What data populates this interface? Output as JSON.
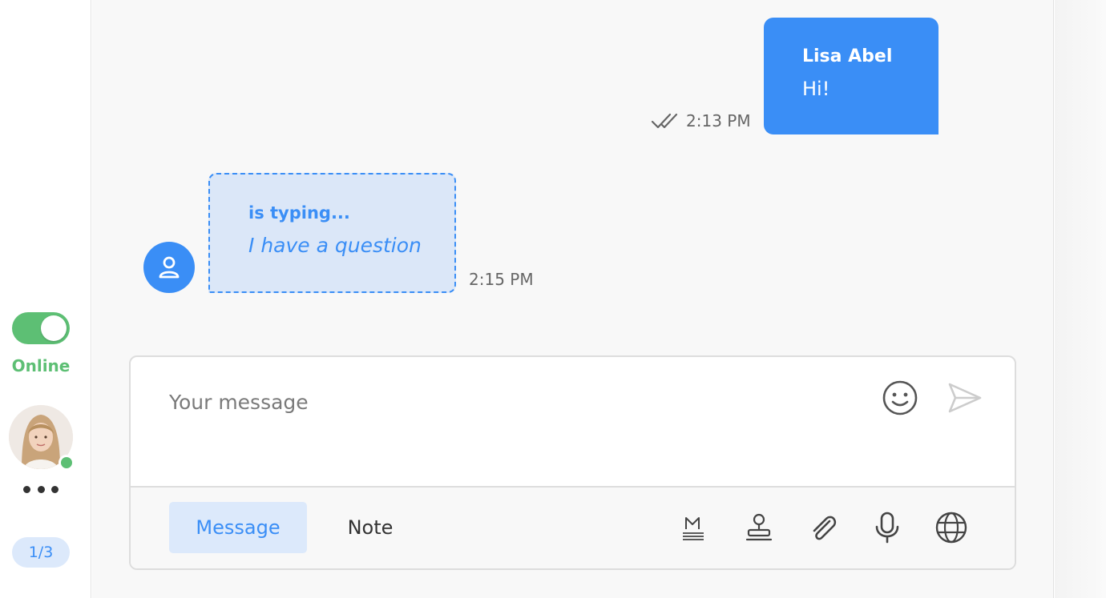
{
  "sidebar": {
    "status_label": "Online",
    "status_on": true,
    "pager": "1/3"
  },
  "messages": [
    {
      "direction": "out",
      "author": "Lisa Abel",
      "text": "Hi!",
      "time": "2:13 PM",
      "read": true
    },
    {
      "direction": "in",
      "typing_label": "is typing...",
      "text": "I have a question",
      "time": "2:15 PM"
    }
  ],
  "composer": {
    "placeholder": "Your message",
    "tabs": [
      {
        "label": "Message",
        "active": true
      },
      {
        "label": "Note",
        "active": false
      }
    ],
    "tools": [
      "markdown-icon",
      "stamp-icon",
      "paperclip-icon",
      "microphone-icon",
      "globe-icon"
    ]
  },
  "colors": {
    "accent": "#3a8ef6",
    "online": "#5dbf74",
    "bubble_typing_bg": "#dbe7f8"
  }
}
